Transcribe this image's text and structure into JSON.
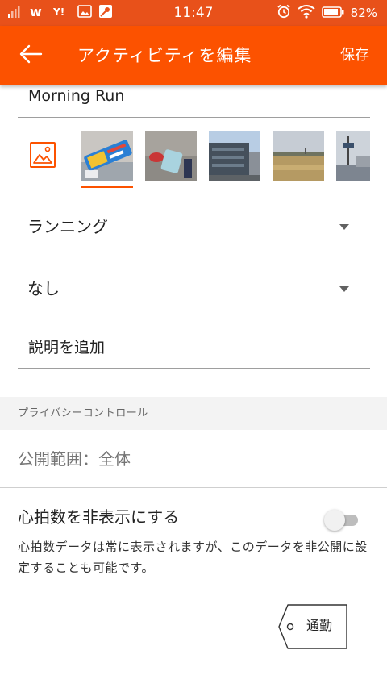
{
  "status_bar": {
    "time": "11:47",
    "battery_text": "82%",
    "icons": [
      "signal-icon",
      "w-app-icon",
      "yahoo-icon",
      "image-notification-icon",
      "maps-notification-icon",
      "alarm-icon",
      "wifi-icon",
      "battery-icon"
    ]
  },
  "header": {
    "title": "アクティビティを編集",
    "save_label": "保存",
    "back_icon": "back-arrow-icon"
  },
  "activity_title": "Morning Run",
  "photos": {
    "add_icon": "add-photo-icon",
    "selected_index": 0,
    "thumbnails": [
      "photo-1",
      "photo-2",
      "photo-3",
      "photo-4",
      "photo-5"
    ]
  },
  "sport_type": {
    "value": "ランニング"
  },
  "gear": {
    "value": "なし"
  },
  "description": {
    "placeholder": "説明を追加"
  },
  "privacy": {
    "section_header": "プライバシーコントロール",
    "visibility": "公開範囲：全体",
    "hide_heart_rate_label": "心拍数を非表示にする",
    "hide_heart_rate_on": false,
    "hide_heart_rate_desc": "心拍数データは常に表示されますが、このデータを非公開に設定することも可能です。"
  },
  "commute_tag": {
    "label": "通勤"
  },
  "colors": {
    "brand_orange": "#fc5200",
    "status_bar": "#e8511a",
    "section_bg": "#f3f3f3"
  }
}
